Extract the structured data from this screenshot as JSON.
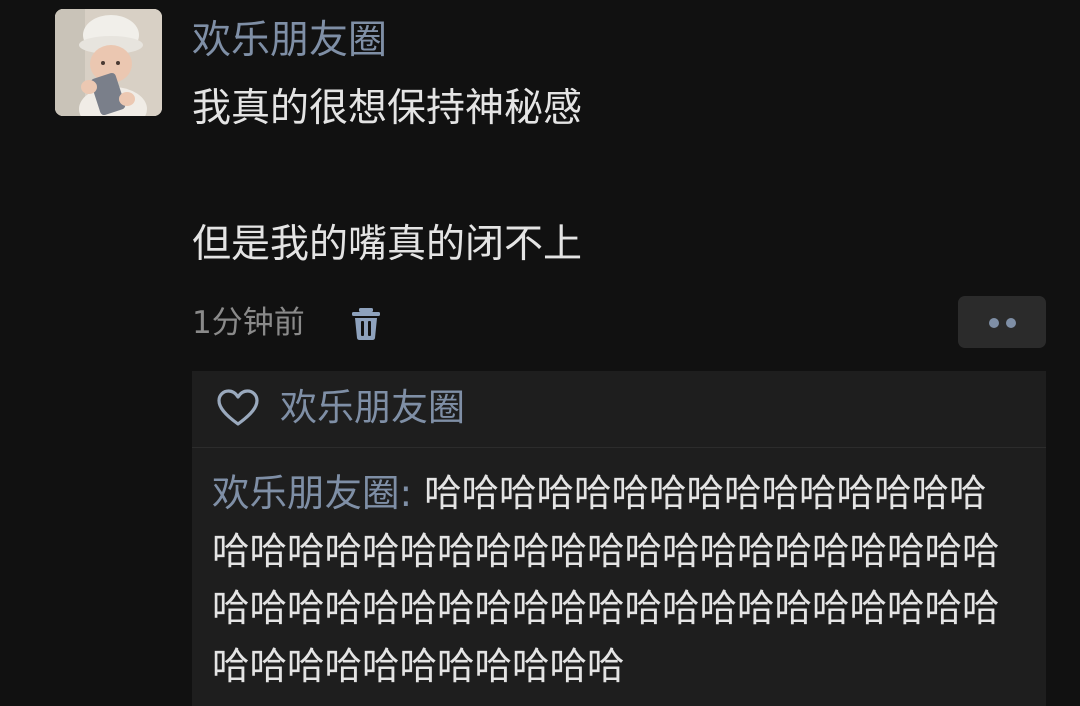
{
  "post": {
    "author": "欢乐朋友圈",
    "content_line1": "我真的很想保持神秘感",
    "content_line2": "但是我的嘴真的闭不上",
    "time": "1分钟前"
  },
  "likes": {
    "names": "欢乐朋友圈"
  },
  "comment": {
    "author": "欢乐朋友圈",
    "separator": ": ",
    "text": "哈哈哈哈哈哈哈哈哈哈哈哈哈哈哈哈哈哈哈哈哈哈哈哈哈哈哈哈哈哈哈哈哈哈哈哈哈哈哈哈哈哈哈哈哈哈哈哈哈哈哈哈哈哈哈哈哈哈哈哈哈哈哈哈哈哈哈哈"
  },
  "icons": {
    "avatar": "baby-with-phone-avatar",
    "delete": "trash-icon",
    "more": "more-dots-icon",
    "like": "heart-outline-icon"
  },
  "colors": {
    "background": "#111111",
    "panel": "#1e1e1e",
    "name_blue": "#7f8fa6",
    "text": "#e4e4e4",
    "muted": "#8a8a8a"
  }
}
